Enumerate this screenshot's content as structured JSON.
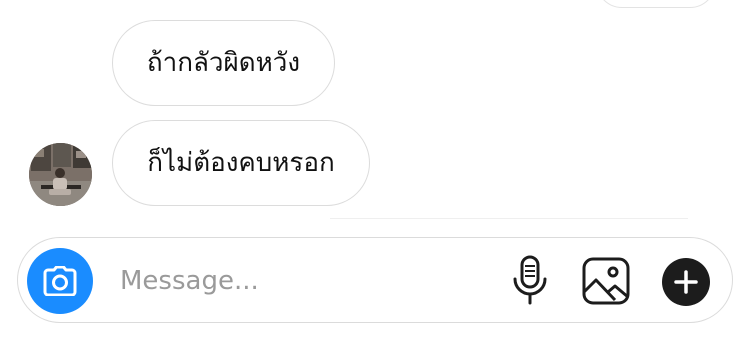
{
  "messages": [
    {
      "sender": "other",
      "text": "ถ้ากลัวผิดหวัง"
    },
    {
      "sender": "other",
      "text": "ก็ไม่ต้องคบหรอก"
    }
  ],
  "contact": {
    "avatar_icon": "avatar-photo"
  },
  "composer": {
    "placeholder": "Message...",
    "value": "",
    "camera_icon": "camera-icon",
    "mic_icon": "microphone-icon",
    "gallery_icon": "gallery-icon",
    "plus_icon": "plus-icon"
  },
  "colors": {
    "accent": "#1a8cff",
    "bubble_border": "#dcdcdc",
    "text": "#111111",
    "placeholder": "#9a9a9a",
    "plus_button": "#1c1c1c"
  }
}
